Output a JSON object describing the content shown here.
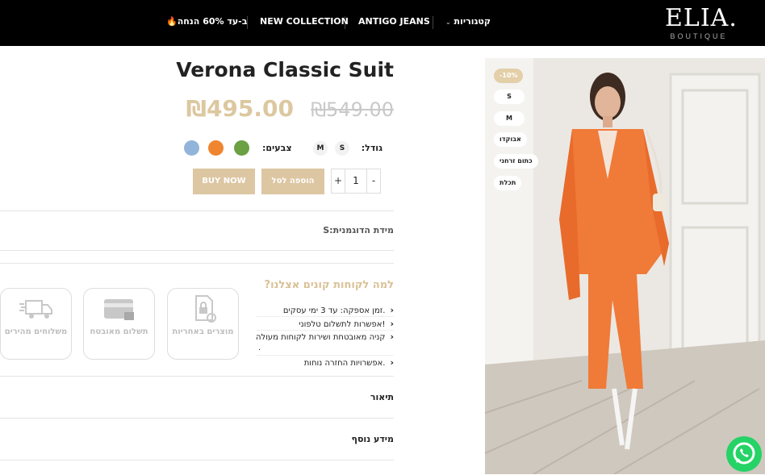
{
  "brand": {
    "name": "ELIA.",
    "tagline": "BOUTIQUE"
  },
  "nav": {
    "categories": "קטגוריות",
    "antigo": "ANTIGO JEANS",
    "new_collection": "NEW COLLECTION",
    "sale": "ב-עד 60% הנחה🔥"
  },
  "product": {
    "title": "Verona Classic Suit",
    "price": "₪495.00",
    "old_price": "₪549.00",
    "size_label": "גודל:",
    "sizes": [
      "S",
      "M"
    ],
    "color_label": "צבעים:",
    "colors": [
      "#6ba043",
      "#f0852f",
      "#93b4da"
    ],
    "quantity": "1",
    "add_to_cart": "הוספה לסל",
    "buy_now": "BUY NOW",
    "model_size": "מידת הדוגמנית:S"
  },
  "why": {
    "title": "למה לקוחות קונים אצלנו?",
    "bullets": [
      "זמן אספקה: עד 3 ימי עסקים.",
      "אפשרות לתשלום טלפוני!",
      "קניה מאובטחת ושירות לקוחות מעולה",
      ".",
      "אפשרויות החזרה נוחות."
    ]
  },
  "features": {
    "warranty": "מוצרים באחריות",
    "secure_payment": "תשלום מאובטח",
    "fast_shipping": "משלוחים מהירים"
  },
  "accordion": {
    "description": "תיאור",
    "more_info": "מידע נוסף"
  },
  "badges": [
    "-10%",
    "S",
    "M",
    "אבוקדו",
    "כתום זרחני",
    "תכלת"
  ],
  "icons": {
    "whatsapp": "whatsapp-icon"
  }
}
